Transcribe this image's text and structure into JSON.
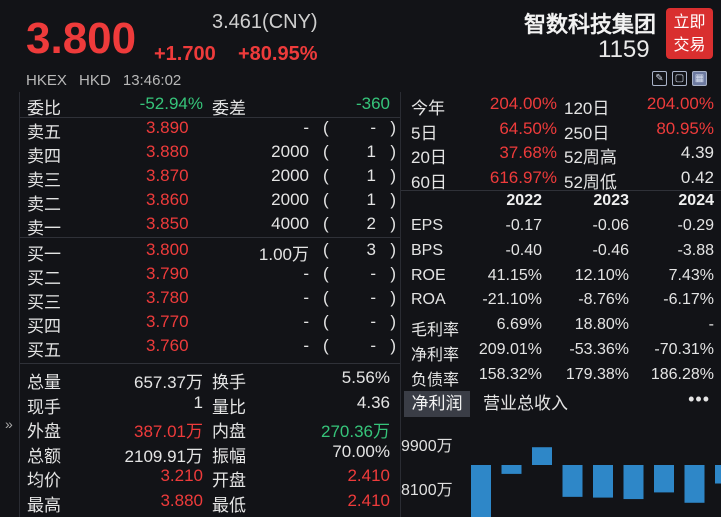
{
  "header": {
    "price": "3.800",
    "ref_price": "3.461(CNY)",
    "change_abs": "+1.700",
    "change_pct": "+80.95%",
    "name": "智数科技集团",
    "code": "1159",
    "trade_button": "立即\n交易",
    "trade_button_line1": "立即",
    "trade_button_line2": "交易",
    "exchange": "HKEX",
    "currency": "HKD",
    "time": "13:46:02"
  },
  "colors": {
    "up": "#ee3b3b",
    "down": "#36c47a",
    "accent_button": "#d92f2f",
    "bar": "#2e87c8"
  },
  "committee": {
    "ratio_label": "委比",
    "ratio_value": "-52.94%",
    "diff_label": "委差",
    "diff_value": "-360"
  },
  "asks": [
    {
      "label": "卖五",
      "price": "3.890",
      "volume": "-",
      "count": "-"
    },
    {
      "label": "卖四",
      "price": "3.880",
      "volume": "2000",
      "count": "1"
    },
    {
      "label": "卖三",
      "price": "3.870",
      "volume": "2000",
      "count": "1"
    },
    {
      "label": "卖二",
      "price": "3.860",
      "volume": "2000",
      "count": "1"
    },
    {
      "label": "卖一",
      "price": "3.850",
      "volume": "4000",
      "count": "2"
    }
  ],
  "bids": [
    {
      "label": "买一",
      "price": "3.800",
      "volume": "1.00万",
      "count": "3"
    },
    {
      "label": "买二",
      "price": "3.790",
      "volume": "-",
      "count": "-"
    },
    {
      "label": "买三",
      "price": "3.780",
      "volume": "-",
      "count": "-"
    },
    {
      "label": "买四",
      "price": "3.770",
      "volume": "-",
      "count": "-"
    },
    {
      "label": "买五",
      "price": "3.760",
      "volume": "-",
      "count": "-"
    }
  ],
  "stats": [
    {
      "l1": "总量",
      "v1": "657.37万",
      "l2": "换手",
      "v2": "5.56%"
    },
    {
      "l1": "现手",
      "v1": "1",
      "l2": "量比",
      "v2": "4.36"
    },
    {
      "l1": "外盘",
      "v1": "387.01万",
      "l2": "内盘",
      "v2": "270.36万"
    },
    {
      "l1": "总额",
      "v1": "2109.91万",
      "l2": "振幅",
      "v2": "70.00%"
    },
    {
      "l1": "均价",
      "v1": "3.210",
      "l2": "开盘",
      "v2": "2.410"
    },
    {
      "l1": "最高",
      "v1": "3.880",
      "l2": "最低",
      "v2": "2.410"
    }
  ],
  "performance": [
    {
      "l1": "今年",
      "v1": "204.00%",
      "l2": "120日",
      "v2": "204.00%"
    },
    {
      "l1": "5日",
      "v1": "64.50%",
      "l2": "250日",
      "v2": "80.95%"
    },
    {
      "l1": "20日",
      "v1": "37.68%",
      "l2": "52周高",
      "v2": "4.39"
    },
    {
      "l1": "60日",
      "v1": "616.97%",
      "l2": "52周低",
      "v2": "0.42"
    }
  ],
  "financials": {
    "years": [
      "2022",
      "2023",
      "2024"
    ],
    "rows": [
      {
        "label": "EPS",
        "values": [
          "-0.17",
          "-0.06",
          "-0.29"
        ]
      },
      {
        "label": "BPS",
        "values": [
          "-0.40",
          "-0.46",
          "-3.88"
        ]
      },
      {
        "label": "ROE",
        "values": [
          "41.15%",
          "12.10%",
          "7.43%"
        ]
      },
      {
        "label": "ROA",
        "values": [
          "-21.10%",
          "-8.76%",
          "-6.17%"
        ]
      },
      {
        "label": "毛利率",
        "values": [
          "6.69%",
          "18.80%",
          "-"
        ]
      },
      {
        "label": "净利率",
        "values": [
          "209.01%",
          "-53.36%",
          "-70.31%"
        ]
      },
      {
        "label": "负债率",
        "values": [
          "158.32%",
          "179.38%",
          "186.28%"
        ]
      }
    ]
  },
  "chart_tabs": {
    "active": "净利润",
    "other": "营业总收入",
    "more": "•••"
  },
  "chart_data": {
    "type": "bar",
    "title": "",
    "y_tick_labels": [
      "9900万",
      "8100万"
    ],
    "series": [
      {
        "values": [
          -8100,
          -1200,
          2400,
          -4300,
          -4400,
          -4600,
          -3700,
          -5100,
          -2500,
          -1000
        ]
      }
    ],
    "ylim": [
      -9900,
      9900
    ]
  }
}
